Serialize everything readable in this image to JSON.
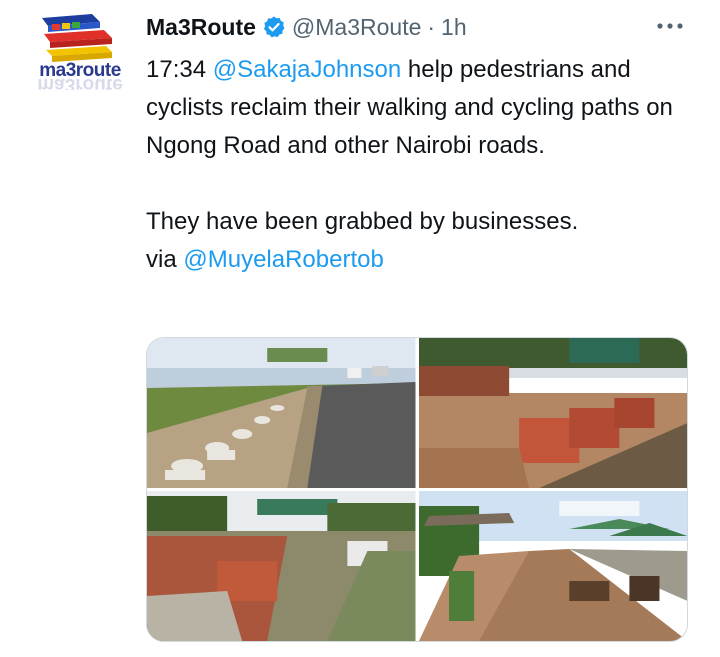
{
  "tweet": {
    "avatar_text": "ma3route",
    "display_name": "Ma3Route",
    "handle": "@Ma3Route",
    "separator": "·",
    "time_ago": "1h",
    "text": {
      "time_prefix": "17:34 ",
      "mention1": "@SakajaJohnson",
      "line1_rest": " help pedestrians and cyclists reclaim their walking and cycling paths on Ngong Road and other Nairobi roads.",
      "line2": "They have been grabbed by businesses.",
      "via_prefix": "via ",
      "mention2": "@MuyelaRobertob"
    },
    "media": [
      {
        "name": "photo-toilets-roadside"
      },
      {
        "name": "photo-bricks-sign"
      },
      {
        "name": "photo-bricks-path"
      },
      {
        "name": "photo-cafe-tents"
      }
    ]
  },
  "icons": {
    "verified": "verified-badge-icon",
    "more": "more-options-icon"
  },
  "colors": {
    "accent": "#1d9bf0",
    "text": "#0f1419",
    "muted": "#536471",
    "border": "#cfd9de"
  }
}
